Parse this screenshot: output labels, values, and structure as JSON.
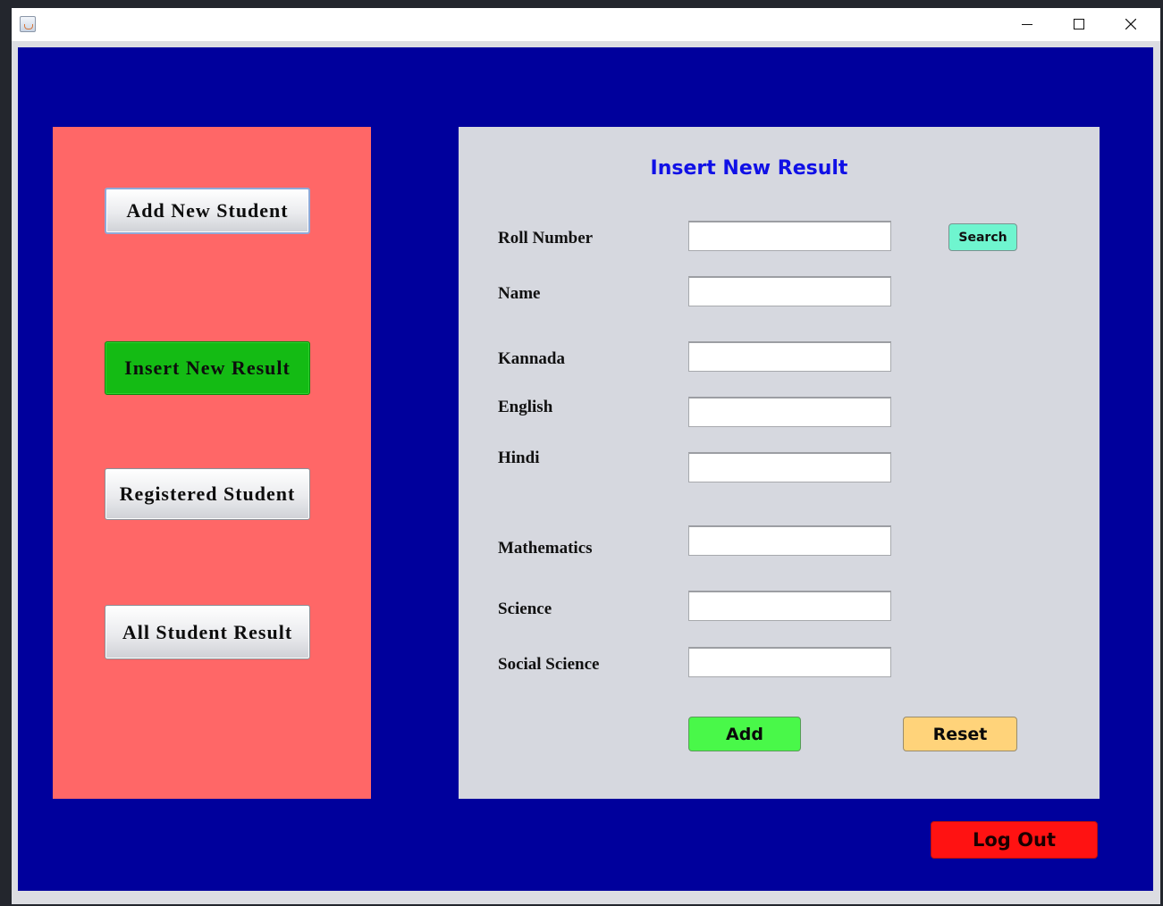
{
  "window": {
    "title": "",
    "controls": {
      "minimize": "minimize",
      "maximize": "maximize",
      "close": "close"
    }
  },
  "sidebar": {
    "items": [
      {
        "label": "Add New Student"
      },
      {
        "label": "Insert New Result",
        "active": true,
        "color": "#14bb14"
      },
      {
        "label": "Registered Student"
      },
      {
        "label": "All Student Result"
      }
    ],
    "background": "#ff6767"
  },
  "form": {
    "title": "Insert New Result",
    "fields": [
      {
        "label": "Roll Number",
        "value": ""
      },
      {
        "label": "Name",
        "value": ""
      },
      {
        "label": "Kannada",
        "value": ""
      },
      {
        "label": "English",
        "value": ""
      },
      {
        "label": "Hindi",
        "value": ""
      },
      {
        "label": "Mathematics",
        "value": ""
      },
      {
        "label": "Science",
        "value": ""
      },
      {
        "label": "Social Science",
        "value": ""
      }
    ],
    "search_label": "Search",
    "add_label": "Add",
    "reset_label": "Reset"
  },
  "logout_label": "Log Out",
  "colors": {
    "background": "#00009c",
    "panel": "#d6d8df",
    "title": "#1010e6",
    "search": "#6ff5cf",
    "add": "#49f849",
    "reset": "#ffd37a",
    "logout": "#ff1212"
  }
}
